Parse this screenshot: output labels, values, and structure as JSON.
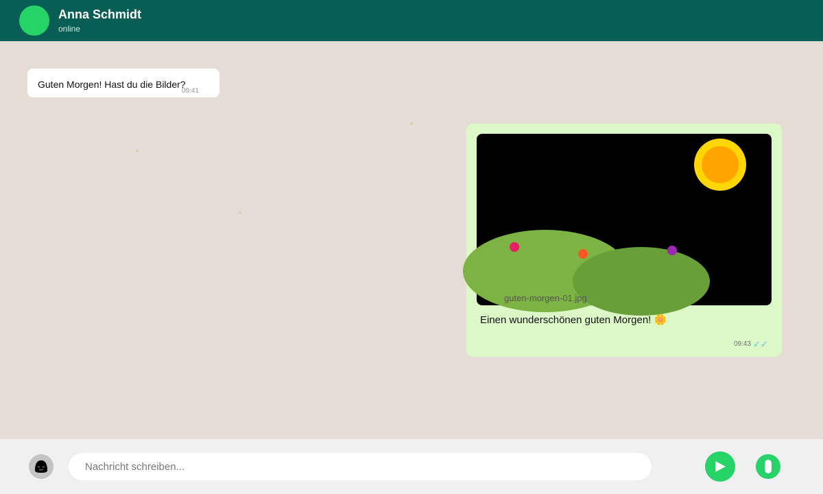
{
  "header": {
    "contact_name": "Anna Schmidt",
    "status": "online",
    "colors": {
      "bar": "#075e54",
      "avatar": "#25d366"
    }
  },
  "messages": [
    {
      "direction": "incoming",
      "text": "Guten Morgen! Hast du die Bilder?",
      "time": "09:41"
    },
    {
      "direction": "outgoing",
      "image_filename": "guten-morgen-01.jpg",
      "caption": "Einen wunderschönen guten Morgen! 🌼",
      "time": "09:43",
      "status_icon": "double-check-icon",
      "status_glyph": "✓✓"
    }
  ],
  "input": {
    "placeholder": "Nachricht schreiben...",
    "value": ""
  },
  "icons": {
    "emoji": "emoji-icon",
    "send": "send-icon",
    "mic": "microphone-icon"
  },
  "colors": {
    "chat_bg": "#e5ddd5",
    "outgoing_bubble": "#dcf8c6",
    "incoming_bubble": "#ffffff",
    "accent": "#25d366",
    "read_ticks": "#4fc3f7"
  }
}
